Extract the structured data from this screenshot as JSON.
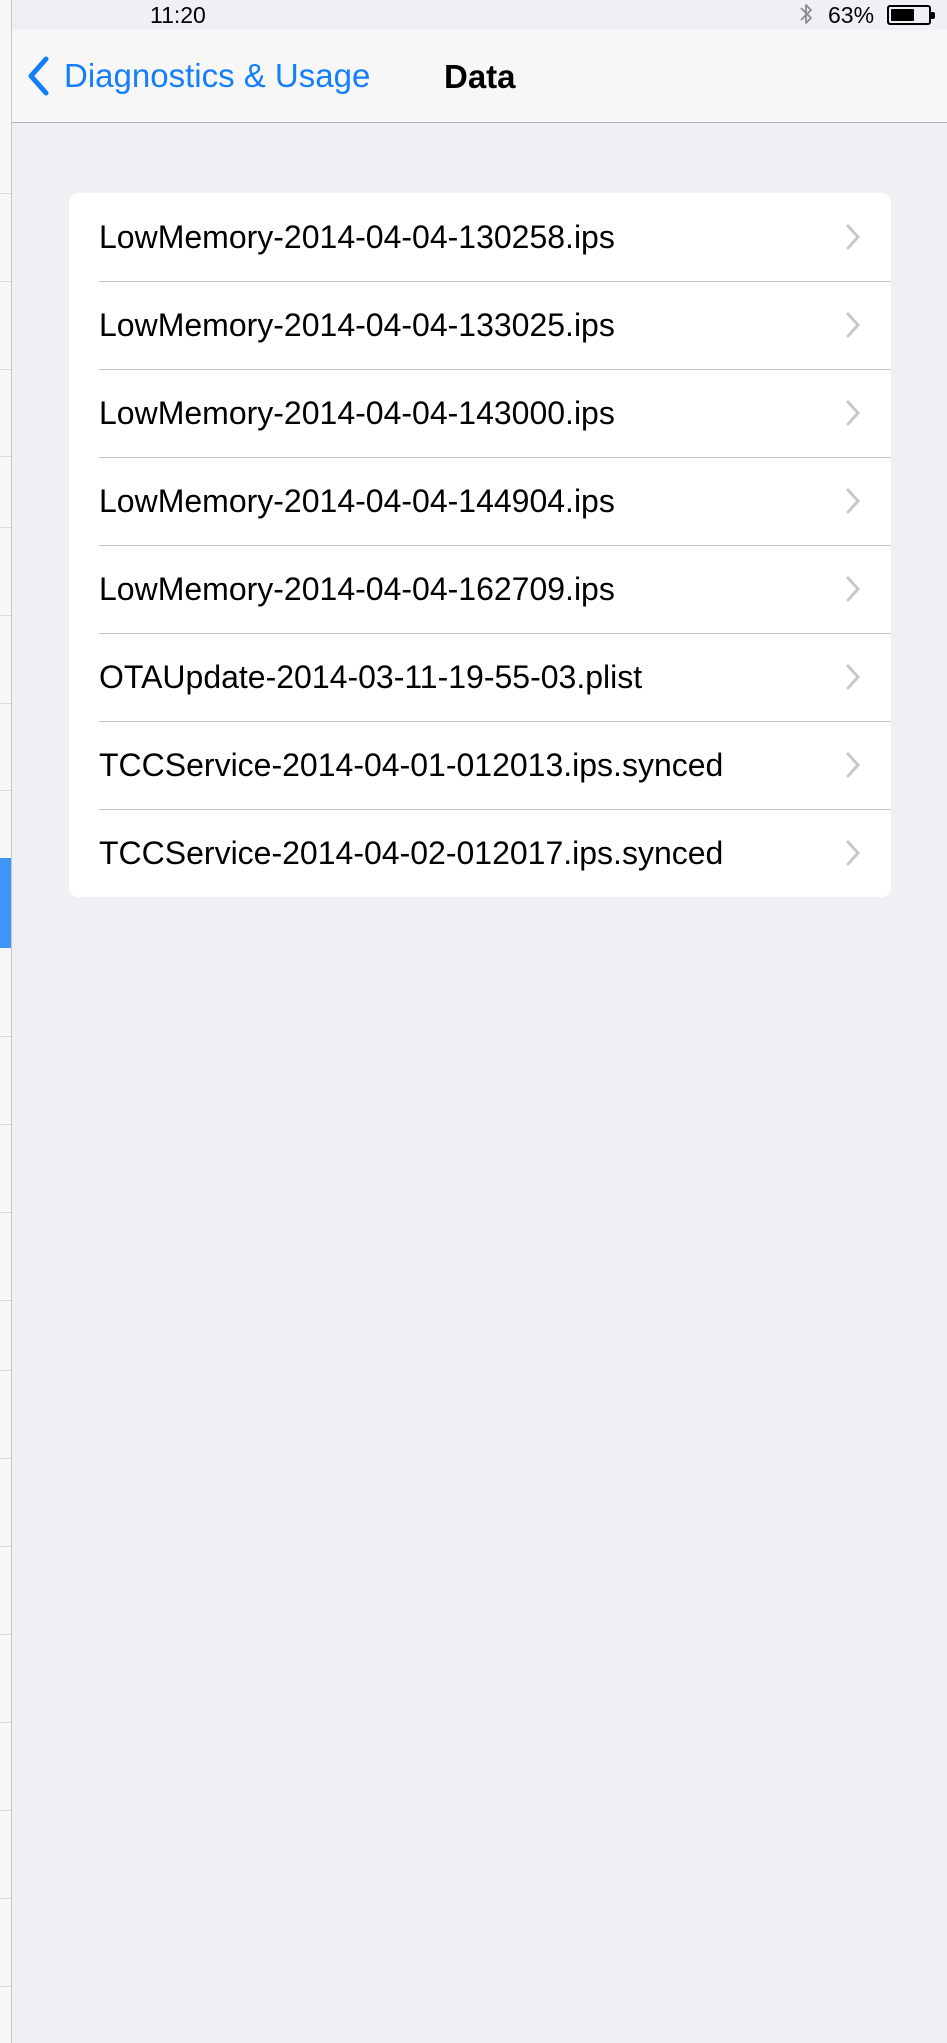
{
  "status_bar": {
    "time": "11:20",
    "bluetooth_icon": "bluetooth-icon",
    "battery_percent": "63%",
    "battery_level": 0.63
  },
  "nav": {
    "back_label": "Diagnostics & Usage",
    "back_icon": "chevron-left-icon",
    "title": "Data",
    "accent_color": "#157efb"
  },
  "files": [
    {
      "name": "LowMemory-2014-04-04-130258.ips"
    },
    {
      "name": "LowMemory-2014-04-04-133025.ips"
    },
    {
      "name": "LowMemory-2014-04-04-143000.ips"
    },
    {
      "name": "LowMemory-2014-04-04-144904.ips"
    },
    {
      "name": "LowMemory-2014-04-04-162709.ips"
    },
    {
      "name": "OTAUpdate-2014-03-11-19-55-03.plist"
    },
    {
      "name": "TCCService-2014-04-01-012013.ips.synced"
    },
    {
      "name": "TCCService-2014-04-02-012017.ips.synced"
    }
  ],
  "row_icon": "chevron-right-icon"
}
